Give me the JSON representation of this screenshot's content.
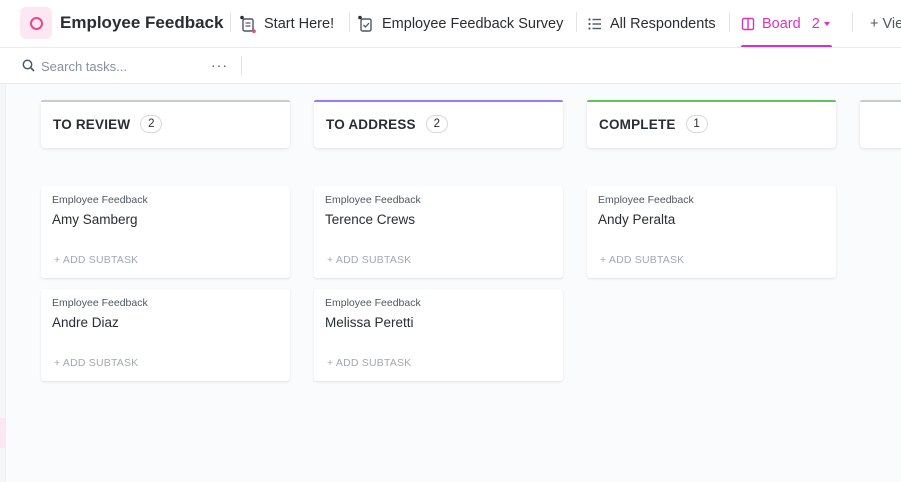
{
  "header": {
    "list_title": "Employee Feedback",
    "tabs": [
      {
        "label": "Start Here!",
        "icon": "doc-icon"
      },
      {
        "label": "Employee Feedback Survey",
        "icon": "form-icon"
      },
      {
        "label": "All Respondents",
        "icon": "list-icon"
      },
      {
        "label": "Board",
        "icon": "board-icon",
        "count": "2",
        "active": true
      },
      {
        "label": "+ Vie",
        "icon": "plus-icon"
      }
    ],
    "accent_color": "#d633c6"
  },
  "toolbar": {
    "search_placeholder": "Search tasks...",
    "more_label": "···"
  },
  "board": {
    "columns": [
      {
        "title": "TO REVIEW",
        "count": "2",
        "color": "#c7cbd2",
        "cards": [
          {
            "list": "Employee Feedback",
            "name": "Amy Samberg",
            "action": "+ ADD SUBTASK"
          },
          {
            "list": "Employee Feedback",
            "name": "Andre Diaz",
            "action": "+ ADD SUBTASK"
          }
        ]
      },
      {
        "title": "TO ADDRESS",
        "count": "2",
        "color": "#9b7bf0",
        "cards": [
          {
            "list": "Employee Feedback",
            "name": "Terence Crews",
            "action": "+ ADD SUBTASK"
          },
          {
            "list": "Employee Feedback",
            "name": "Melissa Peretti",
            "action": "+ ADD SUBTASK"
          }
        ]
      },
      {
        "title": "COMPLETE",
        "count": "1",
        "color": "#5fc25a",
        "cards": [
          {
            "list": "Employee Feedback",
            "name": "Andy Peralta",
            "action": "+ ADD SUBTASK"
          }
        ]
      }
    ]
  }
}
